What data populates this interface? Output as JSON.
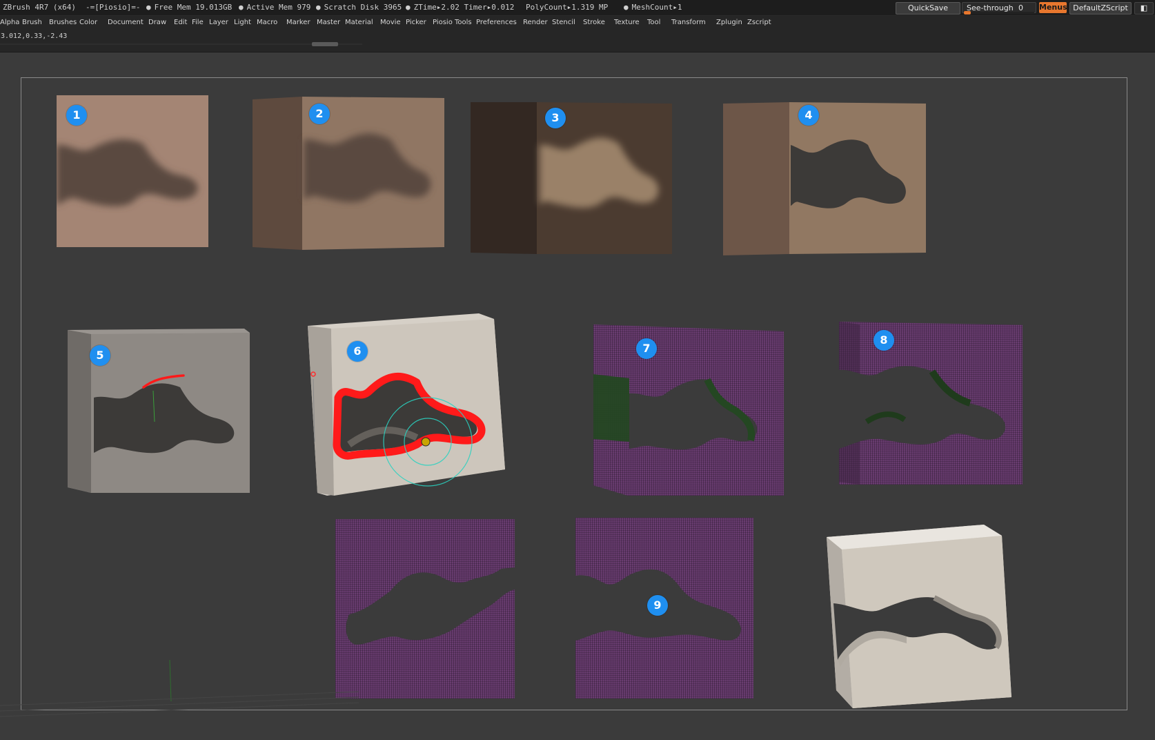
{
  "titlebar": {
    "app": "ZBrush 4R7 (x64)",
    "doc": "-=[Piosio]=-",
    "stats": [
      "Free Mem 19.013GB",
      "Active Mem 979",
      "Scratch Disk 3965",
      "ZTime▸2.02  Timer▸0.012",
      "PolyCount▸1.319 MP",
      "MeshCount▸1"
    ],
    "quicksave": "QuickSave",
    "seethrough_label": "See-through",
    "seethrough_value": "0",
    "seethrough_level": 0,
    "menus": "Menus",
    "defaultzscript": "DefaultZScript"
  },
  "menubar": {
    "items": [
      "Alpha",
      "Brush",
      "Brushes",
      "Color",
      "Document",
      "Draw",
      "Edit",
      "File",
      "Layer",
      "Light",
      "Macro",
      "Marker",
      "Master",
      "Material",
      "Movie",
      "Picker",
      "Piosio Tools",
      "Preferences",
      "Render",
      "Stencil",
      "Stroke",
      "Texture",
      "Tool",
      "Transform",
      "Zplugin",
      "Zscript"
    ]
  },
  "infobar": {
    "coords": "3.012,0.33,-2.43"
  },
  "canvas": {
    "badges": [
      "1",
      "2",
      "3",
      "4",
      "5",
      "6",
      "7",
      "8",
      "9"
    ]
  },
  "colors": {
    "accent": "#e8772e",
    "badge": "#1f8ff0",
    "stroke": "#ff1a1a",
    "mesh": "#6a3d71"
  }
}
